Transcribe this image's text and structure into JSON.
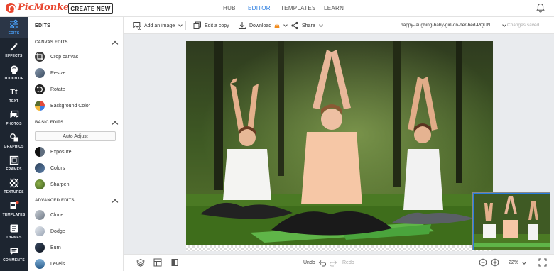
{
  "app": {
    "logo_text": "PicMonkey",
    "create_label": "CREATE NEW"
  },
  "nav": {
    "hub": "HUB",
    "editor": "EDITOR",
    "templates": "TEMPLATES",
    "learn": "LEARN",
    "active": "EDITOR"
  },
  "rail": [
    {
      "label": "EDITS",
      "icon": "sliders-icon",
      "active": true
    },
    {
      "label": "EFFECTS",
      "icon": "magic-wand-icon"
    },
    {
      "label": "TOUCH UP",
      "icon": "face-icon"
    },
    {
      "label": "TEXT",
      "icon": "text-icon",
      "glyph": "Tt"
    },
    {
      "label": "PHOTOS",
      "icon": "photos-icon"
    },
    {
      "label": "GRAPHICS",
      "icon": "graphics-icon"
    },
    {
      "label": "FRAMES",
      "icon": "frames-icon"
    },
    {
      "label": "TEXTURES",
      "icon": "textures-icon"
    },
    {
      "label": "TEMPLATES",
      "icon": "templates-icon"
    },
    {
      "label": "THEMES",
      "icon": "themes-icon"
    },
    {
      "label": "COMMENTS",
      "icon": "comments-icon"
    }
  ],
  "panel": {
    "title": "EDITS",
    "canvas_edits": {
      "heading": "CANVAS EDITS",
      "items": [
        "Crop canvas",
        "Resize",
        "Rotate",
        "Background Color"
      ]
    },
    "basic_edits": {
      "heading": "BASIC EDITS",
      "auto_adjust": "Auto Adjust",
      "items": [
        "Exposure",
        "Colors",
        "Sharpen"
      ]
    },
    "advanced_edits": {
      "heading": "ADVANCED EDITS",
      "items": [
        "Clone",
        "Dodge",
        "Burn",
        "Levels"
      ]
    }
  },
  "toolbar": {
    "add_image": "Add an image",
    "edit_copy": "Edit a copy",
    "download": "Download",
    "share": "Share",
    "file_name": "happy-laughing-baby-girl-on-her-bed-PQUN...",
    "save_status": "Changes saved"
  },
  "bottom": {
    "undo": "Undo",
    "redo": "Redo",
    "zoom": "22%"
  },
  "colors": {
    "accent": "#2a7de1",
    "brand": "#e8462f",
    "rail_bg": "#1d2530"
  }
}
